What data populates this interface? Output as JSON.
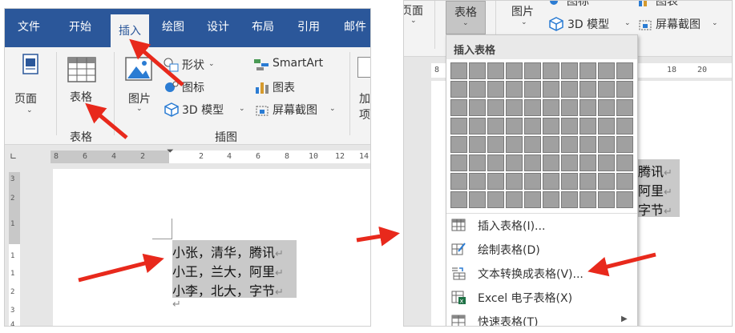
{
  "left_panel": {
    "tabs": [
      "文件",
      "开始",
      "插入",
      "绘图",
      "设计",
      "布局",
      "引用",
      "邮件"
    ],
    "active_tab": "插入",
    "ribbon": {
      "page_label": "页面",
      "table_label": "表格",
      "table_group": "表格",
      "picture_label": "图片",
      "shapes_label": "形状",
      "icons_label": "图标",
      "model3d_label": "3D 模型",
      "smartart_label": "SmartArt",
      "chart_label": "图表",
      "screenshot_label": "屏幕截图",
      "illustrations_group": "插图",
      "addins_label_1": "加",
      "addins_label_2": "项"
    },
    "ruler_ticks": [
      "8",
      "6",
      "4",
      "2",
      "2",
      "4",
      "6",
      "8",
      "10",
      "12",
      "14"
    ],
    "vruler_ticks": [
      "3",
      "2",
      "1",
      "1",
      "1",
      "2",
      "3",
      "4"
    ],
    "doc_lines": [
      "小张，清华，腾讯",
      "小王，兰大，阿里",
      "小李，北大，字节"
    ]
  },
  "right_panel": {
    "ribbon": {
      "page_label": "页面",
      "table_label": "表格",
      "picture_label": "图片",
      "icons_label": "图标",
      "chart_label": "图表",
      "model3d_label": "3D 模型",
      "screenshot_label": "屏幕截图"
    },
    "ruler_ticks": [
      "8",
      "18",
      "20"
    ],
    "doc_fragments": [
      "腾讯",
      "阿里",
      "字节"
    ],
    "dropdown": {
      "header": "插入表格",
      "grid_cols": 10,
      "grid_rows": 8,
      "items": [
        {
          "label": "插入表格(I)...",
          "icon": "table-icon"
        },
        {
          "label": "绘制表格(D)",
          "icon": "draw-table-icon"
        },
        {
          "label": "文本转换成表格(V)...",
          "icon": "text-to-table-icon"
        },
        {
          "label": "Excel 电子表格(X)",
          "icon": "excel-icon"
        },
        {
          "label": "快速表格(T)",
          "icon": "quick-table-icon"
        }
      ]
    }
  },
  "colors": {
    "word_blue": "#2b579a",
    "ribbon_bg": "#f3f3f3",
    "arrow_red": "#e8291c",
    "selection_gray": "#c9c9c9"
  }
}
